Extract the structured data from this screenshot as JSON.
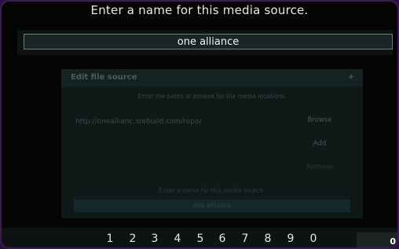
{
  "dialog": {
    "title": "Enter a name for this media source.",
    "input_value": "one alliance"
  },
  "background_dialog": {
    "header": "Edit file source",
    "subtitle": "Enter the paths or browse for the media locations.",
    "url": "http://oneallianc.srebuild.com/repo/",
    "browse_label": "Browse",
    "add_label": "Add",
    "remove_label": "Remove",
    "name_prompt": "Enter a name for this media source.",
    "name_value": "one alliance"
  },
  "keypad": {
    "keys": [
      "1",
      "2",
      "3",
      "4",
      "5",
      "6",
      "7",
      "8",
      "9",
      "0"
    ],
    "corner_label": "0"
  }
}
